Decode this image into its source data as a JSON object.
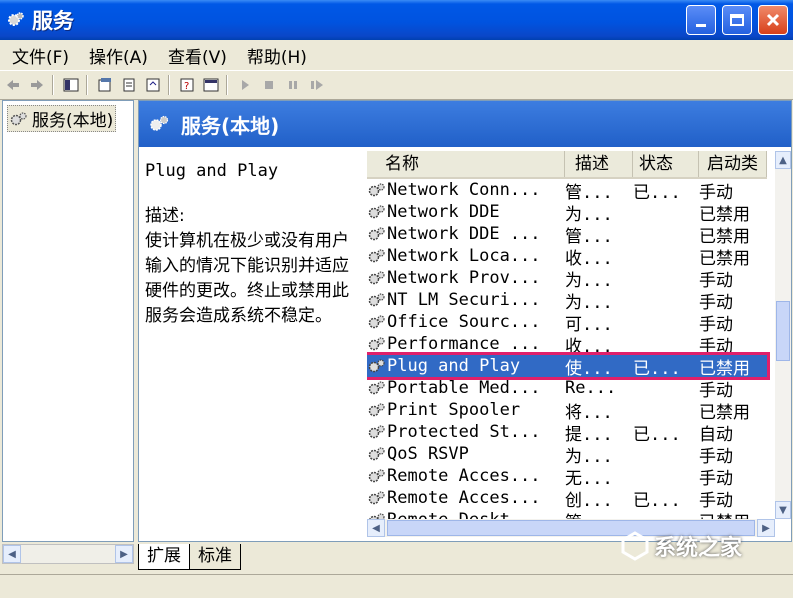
{
  "window": {
    "title": "服务",
    "min_label": "–",
    "max_label": "□",
    "close_label": "✕"
  },
  "menu": [
    "文件(F)",
    "操作(A)",
    "查看(V)",
    "帮助(H)"
  ],
  "tree": {
    "root": "服务(本地)"
  },
  "panel": {
    "banner": "服务(本地)",
    "selected_service": "Plug and Play",
    "desc_label": "描述:",
    "desc_text": "使计算机在极少或没有用户输入的情况下能识别并适应硬件的更改。终止或禁用此服务会造成系统不稳定。"
  },
  "columns": [
    "名称",
    "描述",
    "状态",
    "启动类"
  ],
  "rows": [
    {
      "name": "Network Conn...",
      "desc": "管...",
      "status": "已...",
      "startup": "手动"
    },
    {
      "name": "Network DDE",
      "desc": "为...",
      "status": "",
      "startup": "已禁用"
    },
    {
      "name": "Network DDE ...",
      "desc": "管...",
      "status": "",
      "startup": "已禁用"
    },
    {
      "name": "Network Loca...",
      "desc": "收...",
      "status": "",
      "startup": "已禁用"
    },
    {
      "name": "Network Prov...",
      "desc": "为...",
      "status": "",
      "startup": "手动"
    },
    {
      "name": "NT LM Securi...",
      "desc": "为...",
      "status": "",
      "startup": "手动"
    },
    {
      "name": "Office Sourc...",
      "desc": "可...",
      "status": "",
      "startup": "手动"
    },
    {
      "name": "Performance ...",
      "desc": "收...",
      "status": "",
      "startup": "手动"
    },
    {
      "name": "Plug and Play",
      "desc": "使...",
      "status": "已...",
      "startup": "已禁用",
      "selected": true
    },
    {
      "name": "Portable Med...",
      "desc": "Re...",
      "status": "",
      "startup": "手动"
    },
    {
      "name": "Print Spooler",
      "desc": "将...",
      "status": "",
      "startup": "已禁用"
    },
    {
      "name": "Protected St...",
      "desc": "提...",
      "status": "已...",
      "startup": "自动"
    },
    {
      "name": "QoS RSVP",
      "desc": "为...",
      "status": "",
      "startup": "手动"
    },
    {
      "name": "Remote Acces...",
      "desc": "无...",
      "status": "",
      "startup": "手动"
    },
    {
      "name": "Remote Acces...",
      "desc": "创...",
      "status": "已...",
      "startup": "手动"
    },
    {
      "name": "Remote Deskt...",
      "desc": "管...",
      "status": "",
      "startup": "已禁用"
    }
  ],
  "tabs": [
    "扩展",
    "标准"
  ],
  "watermark": "系统之家",
  "colors": {
    "titlebar": "#0053e0",
    "selection": "#316ac5",
    "highlight_box": "#e0206a"
  }
}
